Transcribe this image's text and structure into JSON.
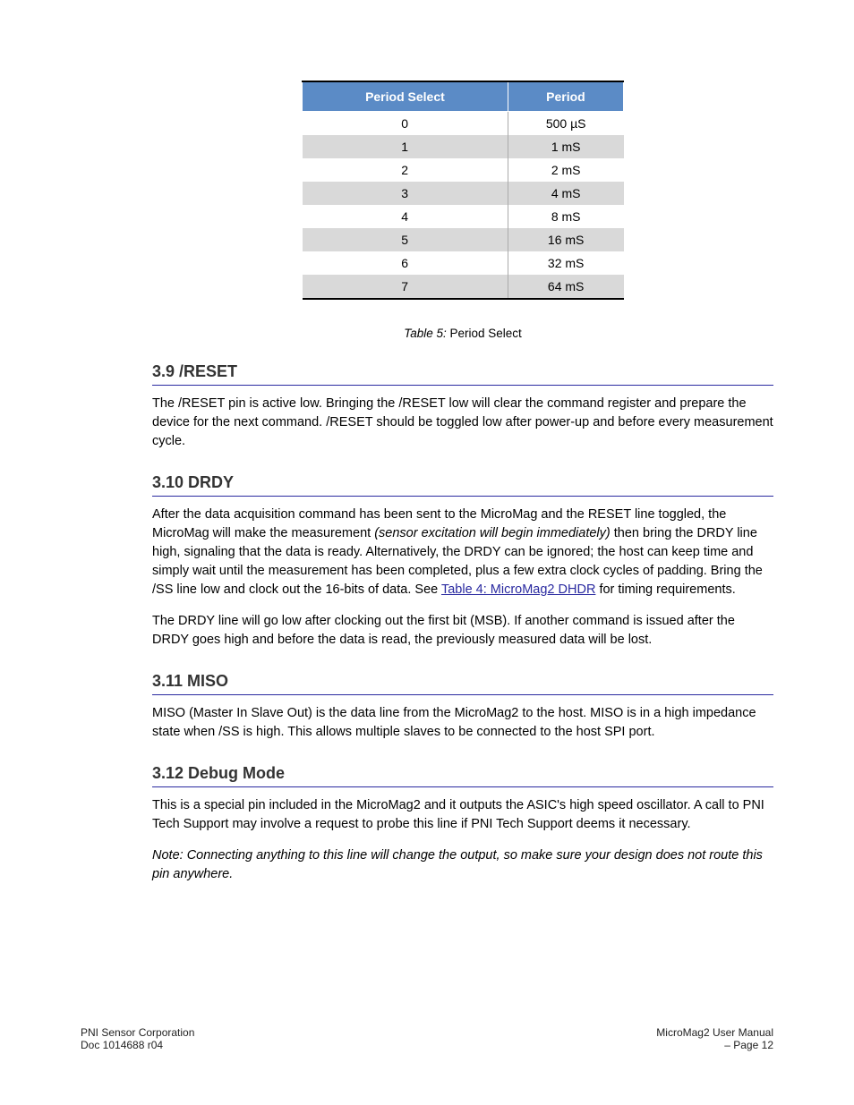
{
  "table": {
    "headers": [
      "Period Select",
      "Period"
    ],
    "rows": [
      {
        "ps": "0",
        "p": "500 µS"
      },
      {
        "ps": "1",
        "p": "1 mS"
      },
      {
        "ps": "2",
        "p": "2 mS"
      },
      {
        "ps": "3",
        "p": "4 mS"
      },
      {
        "ps": "4",
        "p": "8 mS"
      },
      {
        "ps": "5",
        "p": "16 mS"
      },
      {
        "ps": "6",
        "p": "32 mS"
      },
      {
        "ps": "7",
        "p": "64 mS"
      }
    ],
    "caption_label": "Table 5:",
    "caption_text": "Period Select"
  },
  "sections": {
    "reset": {
      "title": "3.9 /RESET",
      "body": "The /RESET pin is active low. Bringing the /RESET low will clear the command register and prepare the device for the next command. /RESET should be toggled low after power-up and before every measurement cycle."
    },
    "drdy": {
      "title": "3.10 DRDY",
      "body1": "After the data acquisition command has been sent to the MicroMag and the RESET line toggled, the MicroMag will make the measurement ",
      "body1_italic": "(sensor excitation will begin immediately)",
      "body1_cont": " then bring the DRDY line high, signaling that the data is ready. Alternatively, the DRDY can be ignored; the host can keep time and simply wait until the measurement has been completed, plus a few extra clock cycles of padding. Bring the /SS line low and clock out the 16-bits of data. See ",
      "body1_link": "Table 4: MicroMag2 DHDR",
      "body1_end": " for timing requirements.",
      "body2": "The DRDY line will go low after clocking out the first bit (MSB). If another command is issued after the DRDY goes high and before the data is read, the previously measured data will be lost."
    },
    "miso": {
      "title": "3.11 MISO",
      "body": "MISO (Master In Slave Out) is the data line from the MicroMag2 to the host. MISO is in a high impedance state when /SS is high. This allows multiple slaves to be connected to the host SPI port."
    },
    "debug": {
      "title": "3.12 Debug Mode",
      "body1": "This is a special pin included in the MicroMag2 and it outputs the ASIC's high speed oscillator. A call to PNI Tech Support may involve a request to probe this line if PNI Tech Support deems it necessary.",
      "body2_italic": "Note:",
      "body2": " Connecting anything to this line will change the output, so make sure your design does not route this pin anywhere."
    }
  },
  "footer": {
    "left": "PNI Sensor Corporation",
    "left2": "Doc 1014688 r04",
    "right_label": "MicroMag2 User Manual",
    "right_page_label": "– Page",
    "right_page_num": "12"
  }
}
